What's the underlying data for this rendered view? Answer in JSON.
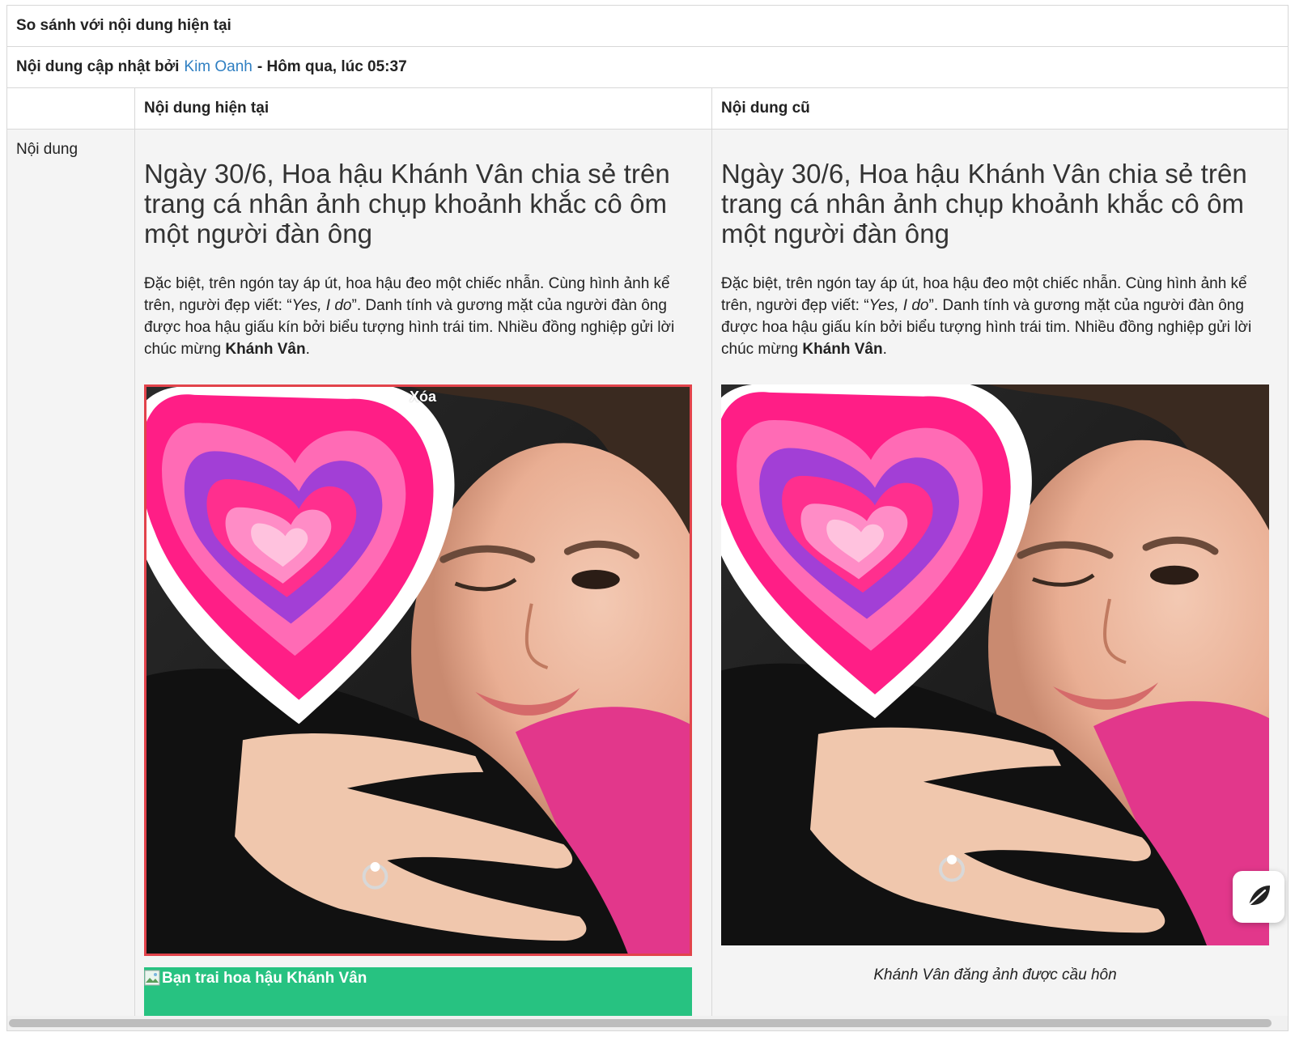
{
  "header": {
    "title": "So sánh với nội dung hiện tại",
    "meta_prefix": "Nội dung cập nhật bởi",
    "author": "Kim Oanh",
    "meta_suffix": "- Hôm qua, lúc 05:37"
  },
  "table": {
    "col_current": "Nội dung hiện tại",
    "col_old": "Nội dung cũ",
    "row_label": "Nội dung"
  },
  "current": {
    "headline": "Ngày 30/6, Hoa hậu Khánh Vân chia sẻ trên trang cá nhân ảnh chụp khoảnh khắc cô ôm một người đàn ông",
    "para_1": "Đặc biệt, trên ngón tay áp út, hoa hậu đeo một chiếc nhẫn. Cùng hình ảnh kể trên, người đẹp viết: “",
    "para_quote": "Yes, I do",
    "para_2": "”. Danh tính và gương mặt của người đàn ông được hoa hậu giấu kín bởi biểu tượng hình trái tim. Nhiều đồng nghiệp gửi lời chúc mừng ",
    "para_bold": "Khánh Vân",
    "para_end": ".",
    "deleted_label": "Xóa",
    "inserted_alt": "Bạn trai hoa hậu Khánh Vân"
  },
  "old": {
    "headline": "Ngày 30/6, Hoa hậu Khánh Vân chia sẻ trên trang cá nhân ảnh chụp khoảnh khắc cô ôm một người đàn ông",
    "para_1": "Đặc biệt, trên ngón tay áp út, hoa hậu đeo một chiếc nhẫn. Cùng hình ảnh kể trên, người đẹp viết: “",
    "para_quote": "Yes, I do",
    "para_2": "”. Danh tính và gương mặt của người đàn ông được hoa hậu giấu kín bởi biểu tượng hình trái tim. Nhiều đồng nghiệp gửi lời chúc mừng ",
    "para_bold": "Khánh Vân",
    "para_end": ".",
    "caption": "Khánh Vân đăng ảnh được cầu hôn"
  },
  "colors": {
    "accent_link": "#2f7fc2",
    "deleted_border": "#e2434b",
    "inserted_bg": "#27c281"
  },
  "icons": {
    "floating_button": "leaf-icon",
    "broken_image": "broken-image-icon"
  }
}
